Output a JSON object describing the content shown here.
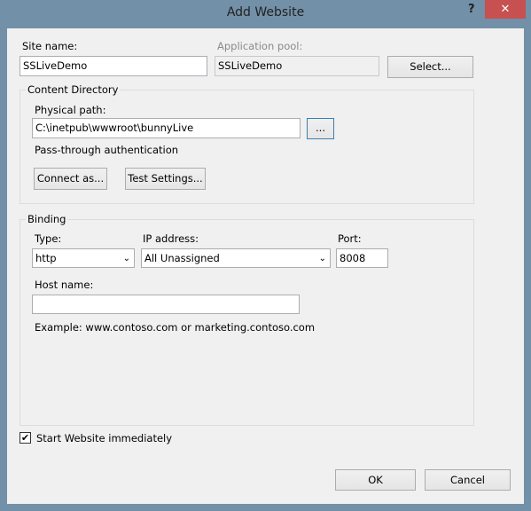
{
  "window": {
    "title": "Add Website",
    "help": "?",
    "close": "✕"
  },
  "site": {
    "label": "Site name:",
    "value": "SSLiveDemo"
  },
  "app_pool": {
    "label": "Application pool:",
    "value": "SSLiveDemo",
    "select_label": "Select..."
  },
  "content": {
    "group_label": "Content Directory",
    "path_label": "Physical path:",
    "path_value": "C:\\inetpub\\wwwroot\\bunnyLive",
    "browse_label": "...",
    "auth_text": "Pass-through authentication",
    "connect_label": "Connect as...",
    "test_label": "Test Settings..."
  },
  "binding": {
    "group_label": "Binding",
    "type_label": "Type:",
    "type_value": "http",
    "ip_label": "IP address:",
    "ip_value": "All Unassigned",
    "port_label": "Port:",
    "port_value": "8008",
    "host_label": "Host name:",
    "host_value": "",
    "example": "Example: www.contoso.com or marketing.contoso.com"
  },
  "start": {
    "label": "Start Website immediately",
    "checked": true,
    "mark": "✔"
  },
  "footer": {
    "ok": "OK",
    "cancel": "Cancel"
  }
}
